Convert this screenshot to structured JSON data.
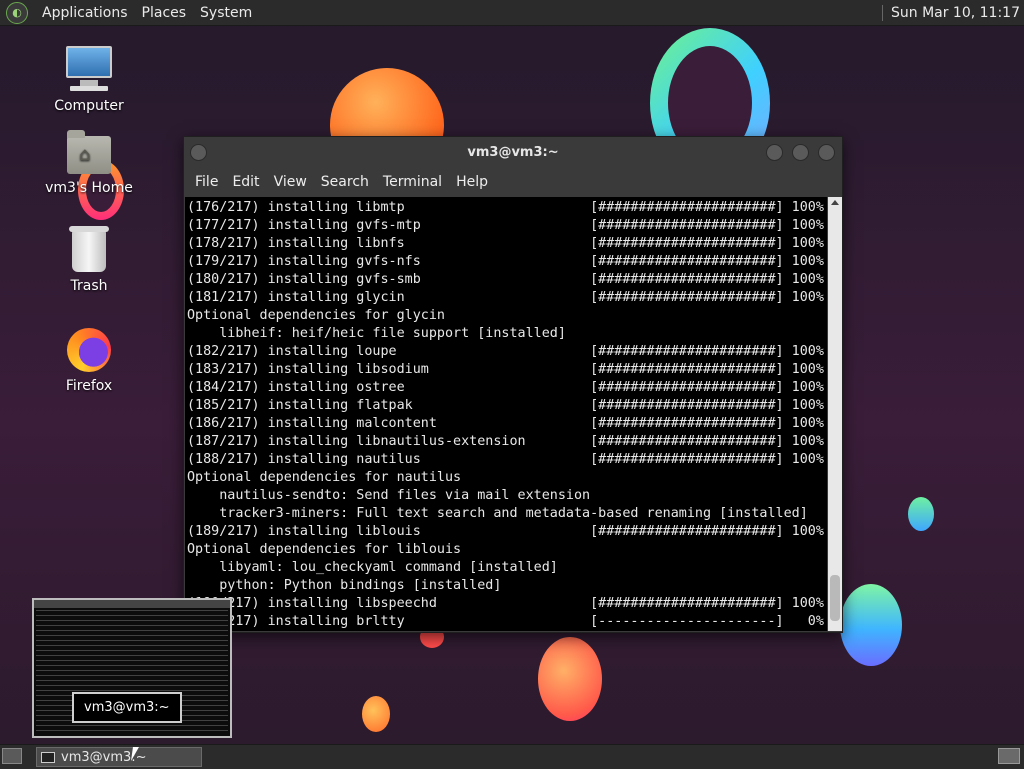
{
  "top_panel": {
    "menus": [
      "Applications",
      "Places",
      "System"
    ],
    "clock": "Sun Mar 10, 11:17"
  },
  "desktop": {
    "icons": [
      {
        "label": "Computer",
        "icon": "computer-icon"
      },
      {
        "label": "vm3's Home",
        "icon": "home-folder-icon"
      },
      {
        "label": "Trash",
        "icon": "trash-icon"
      },
      {
        "label": "Firefox",
        "icon": "firefox-icon"
      }
    ]
  },
  "window": {
    "title": "vm3@vm3:~",
    "menu": [
      "File",
      "Edit",
      "View",
      "Search",
      "Terminal",
      "Help"
    ],
    "terminal_lines": [
      "(176/217) installing libmtp                       [######################] 100%",
      "(177/217) installing gvfs-mtp                     [######################] 100%",
      "(178/217) installing libnfs                       [######################] 100%",
      "(179/217) installing gvfs-nfs                     [######################] 100%",
      "(180/217) installing gvfs-smb                     [######################] 100%",
      "(181/217) installing glycin                       [######################] 100%",
      "Optional dependencies for glycin",
      "    libheif: heif/heic file support [installed]",
      "(182/217) installing loupe                        [######################] 100%",
      "(183/217) installing libsodium                    [######################] 100%",
      "(184/217) installing ostree                       [######################] 100%",
      "(185/217) installing flatpak                      [######################] 100%",
      "(186/217) installing malcontent                   [######################] 100%",
      "(187/217) installing libnautilus-extension        [######################] 100%",
      "(188/217) installing nautilus                     [######################] 100%",
      "Optional dependencies for nautilus",
      "    nautilus-sendto: Send files via mail extension",
      "    tracker3-miners: Full text search and metadata-based renaming [installed]",
      "(189/217) installing liblouis                     [######################] 100%",
      "Optional dependencies for liblouis",
      "    libyaml: lou_checkyaml command [installed]",
      "    python: Python bindings [installed]",
      "(190/217) installing libspeechd                   [######################] 100%",
      "(191/217) installing brltty                       [----------------------]   0%"
    ]
  },
  "preview": {
    "label": "vm3@vm3:~"
  },
  "taskbar": {
    "task_label": "vm3@vm3:~"
  }
}
